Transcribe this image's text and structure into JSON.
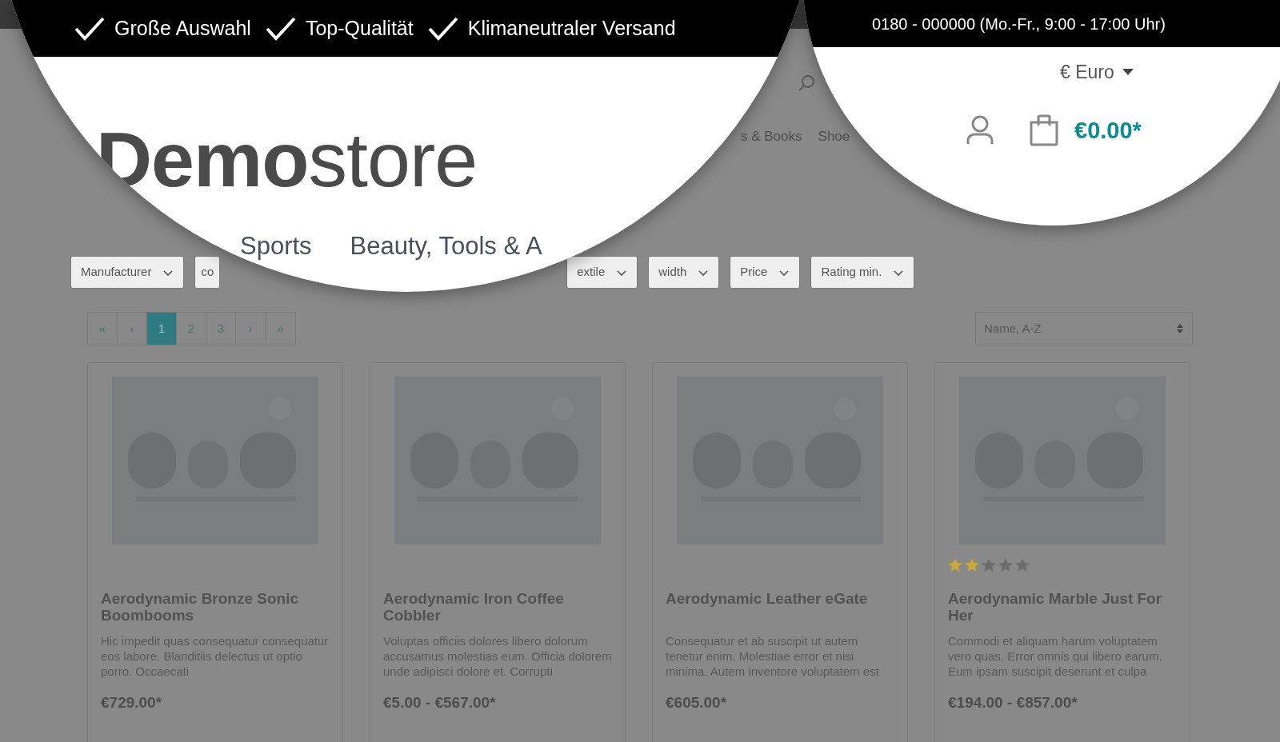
{
  "top_bar": {
    "benefits": [
      "Große Auswahl",
      "Top-Qualität",
      "Klimaneutraler Versand"
    ],
    "phone": "0180 - 000000 (Mo.-Fr., 9:00 - 17:00 Uhr)"
  },
  "logo": {
    "bold": "Demo",
    "light": "store"
  },
  "currency": "€ Euro",
  "cart_total": "€0.00*",
  "magnified_nav": [
    "Sports",
    "Beauty, Tools & A"
  ],
  "nav": [
    "s & Books",
    "Shoe"
  ],
  "filters": [
    {
      "label": "Manufacturer",
      "kind": "dropdown"
    },
    {
      "label": "co",
      "kind": "partial"
    },
    {
      "label": "extile",
      "kind": "dropdown"
    },
    {
      "label": "width",
      "kind": "dropdown"
    },
    {
      "label": "Price",
      "kind": "dropdown"
    },
    {
      "label": "Rating min.",
      "kind": "dropdown"
    }
  ],
  "pagination": [
    {
      "label": "«",
      "selected": false
    },
    {
      "label": "‹",
      "selected": false
    },
    {
      "label": "1",
      "selected": true
    },
    {
      "label": "2",
      "selected": false
    },
    {
      "label": "3",
      "selected": false
    },
    {
      "label": "›",
      "selected": false
    },
    {
      "label": "»",
      "selected": false
    }
  ],
  "sort": {
    "value": "Name, A-Z"
  },
  "products": [
    {
      "name": "Aerodynamic Bronze Sonic Boombooms",
      "description": "Hic impedit quas consequatur consequatur eos labore. Blanditiis delectus ut optio porro. Occaecati",
      "price": "€729.00*"
    },
    {
      "name": "Aerodynamic Iron Coffee Cobbler",
      "description": "Voluptas officiis dolores libero dolorum accusamus molestias eum. Officia dolorem unde adipisci dolore et. Corrupti",
      "price": "€5.00 - €567.00*"
    },
    {
      "name": "Aerodynamic Leather eGate",
      "description": "Consequatur et ab suscipit ut autem tenetur enim. Molestiae error et nisi minima. Autem inventore voluptatem est",
      "price": "€605.00*"
    },
    {
      "name": "Aerodynamic Marble Just For Her",
      "description": "Commodi et aliquam harum voluptatem vero quas. Error omnis qui libero earum. Eum ipsam suscipit deserunt et culpa",
      "price": "€194.00 - €857.00*",
      "stars": 2
    }
  ]
}
